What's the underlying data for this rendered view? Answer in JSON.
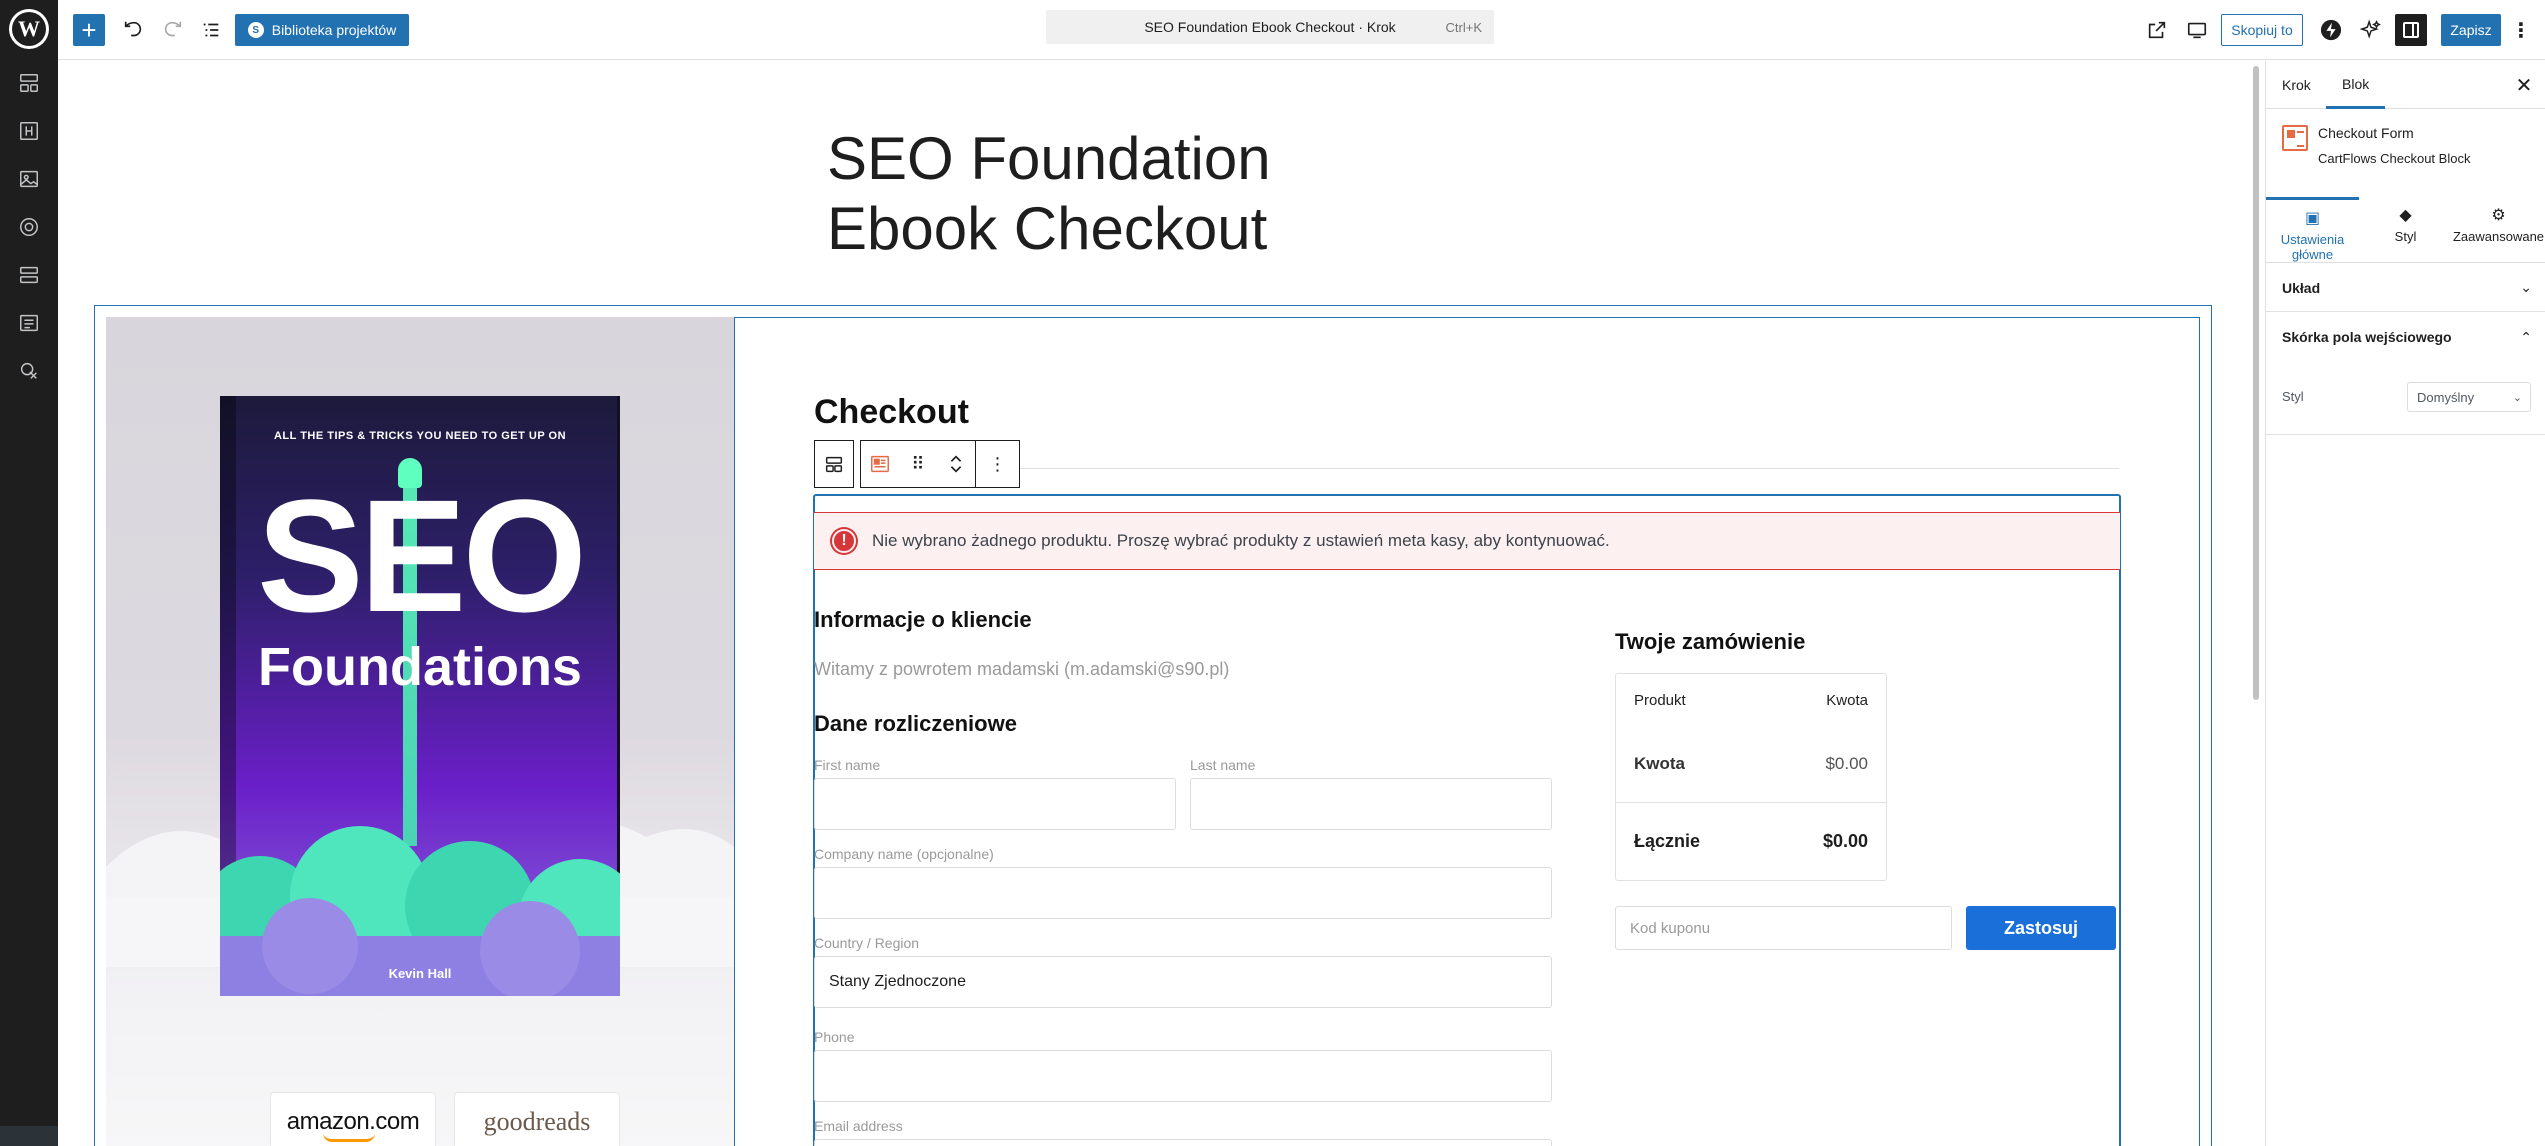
{
  "toolbar": {
    "add_label": "+",
    "project_library": "Biblioteka projektów",
    "document_title": "SEO Foundation Ebook Checkout · Krok",
    "shortcut": "Ctrl+K",
    "copy_label": "Skopiuj to",
    "save_label": "Zapisz"
  },
  "page": {
    "title": "SEO Foundation Ebook Checkout"
  },
  "book": {
    "tagline": "ALL THE TIPS & TRICKS YOU NEED TO GET UP ON",
    "title": "SEO",
    "subtitle": "Foundations",
    "author": "Kevin Hall"
  },
  "logos": {
    "amazon": "amazon.com",
    "goodreads": "goodreads"
  },
  "checkout": {
    "heading": "Checkout",
    "notice": "Nie wybrano żadnego produktu. Proszę wybrać produkty z ustawień meta kasy, aby kontynuować.",
    "customer_heading": "Informacje o kliencie",
    "welcome": "Witamy z powrotem madamski (m.adamski@s90.pl)",
    "billing_heading": "Dane rozliczeniowe",
    "fields": {
      "first_name": "First name",
      "last_name": "Last name",
      "company": "Company name (opcjonalne)",
      "country": "Country / Region",
      "country_value": "Stany Zjednoczone",
      "phone": "Phone",
      "email": "Email address"
    },
    "order": {
      "heading": "Twoje zamówienie",
      "col_product": "Produkt",
      "col_amount": "Kwota",
      "rows": [
        {
          "label": "Kwota",
          "value": "$0.00"
        },
        {
          "label": "Łącznie",
          "value": "$0.00"
        }
      ],
      "coupon_placeholder": "Kod kuponu",
      "apply_label": "Zastosuj"
    }
  },
  "panel": {
    "tab_step": "Krok",
    "tab_block": "Blok",
    "block_title": "Checkout Form",
    "block_desc": "CartFlows Checkout Block",
    "inner_tabs": [
      "Ustawienia główne",
      "Styl",
      "Zaawansowane"
    ],
    "sections": {
      "layout": "Układ",
      "input_skin": "Skórka pola wejściowego"
    },
    "style_label": "Styl",
    "style_value": "Domyślny"
  },
  "colors": {
    "accent": "#2271b1",
    "apply_button": "#1a6fd8",
    "error": "#d63638",
    "sidebar": "#1e1e1e"
  }
}
